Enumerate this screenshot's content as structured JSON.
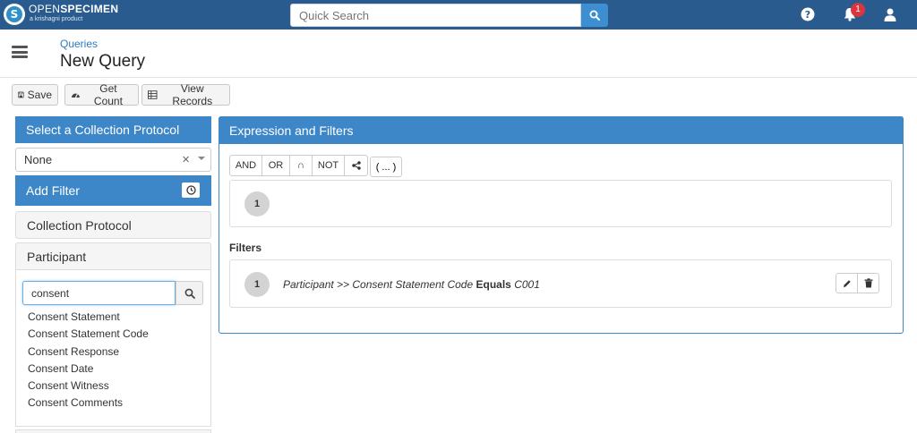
{
  "app": {
    "brand_open": "OPEN",
    "brand_specimen": "SPECIMEN",
    "brand_sub": "a krishagni product",
    "logo_glyph": "S"
  },
  "search": {
    "placeholder": "Quick Search"
  },
  "notifications": {
    "count": "1"
  },
  "header": {
    "breadcrumb": "Queries",
    "title": "New Query"
  },
  "toolbar": {
    "save": "Save",
    "get_count": "Get Count",
    "view_records": "View Records"
  },
  "left_panel": {
    "cp_header": "Select a Collection Protocol",
    "cp_selected": "None",
    "add_filter": "Add Filter",
    "forms": [
      "Collection Protocol",
      "Participant"
    ],
    "field_search_value": "consent",
    "fields": [
      "Consent Statement",
      "Consent Statement Code",
      "Consent Response",
      "Consent Date",
      "Consent Witness",
      "Consent Comments"
    ]
  },
  "right_panel": {
    "header": "Expression and Filters",
    "operators": [
      "AND",
      "OR",
      "∩",
      "NOT"
    ],
    "paren": "( ... )",
    "expression_items": [
      "1"
    ],
    "filters_heading": "Filters",
    "filters": [
      {
        "num": "1",
        "path": "Participant >> Consent Statement Code",
        "op": "Equals",
        "value": "C001"
      }
    ]
  },
  "colors": {
    "navbar": "#2a5b8e",
    "accent": "#3d87c8",
    "badge": "#d9363e"
  }
}
